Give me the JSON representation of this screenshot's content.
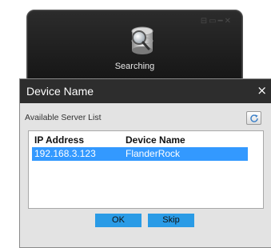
{
  "search_window": {
    "status_label": "Searching",
    "controls": [
      "⊟",
      "▭",
      "━",
      "✕"
    ]
  },
  "dialog": {
    "title": "Device Name",
    "close_glyph": "×",
    "server_list_label": "Available Server List",
    "columns": [
      "IP Address",
      "Device Name"
    ],
    "rows": [
      {
        "ip": "192.168.3.123",
        "device": "FlanderRock",
        "selected": true
      }
    ],
    "ok_label": "OK",
    "skip_label": "Skip"
  },
  "colors": {
    "selection": "#3399ff",
    "button": "#2a9be6",
    "header_bar": "#2d2d2d"
  }
}
